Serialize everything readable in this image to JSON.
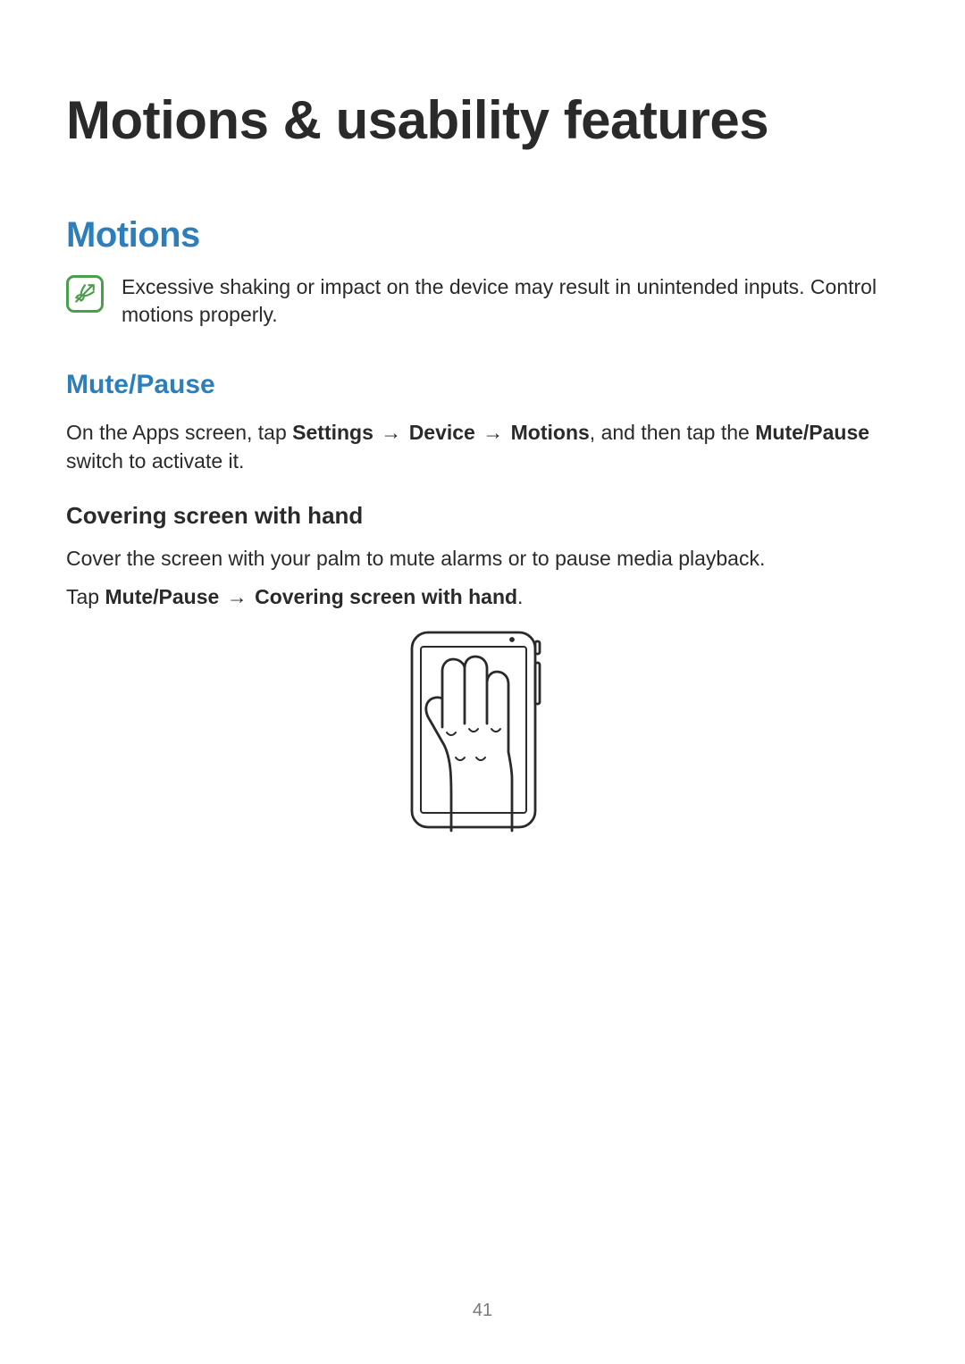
{
  "title": "Motions & usability features",
  "section_motions": {
    "heading": "Motions",
    "note": "Excessive shaking or impact on the device may result in unintended inputs. Control motions properly."
  },
  "mute_pause": {
    "heading": "Mute/Pause",
    "intro_pre": "On the Apps screen, tap ",
    "intro_b1": "Settings",
    "arrow": " → ",
    "intro_b2": "Device",
    "intro_b3": "Motions",
    "intro_mid": ", and then tap the ",
    "intro_b4": "Mute/Pause",
    "intro_post": " switch to activate it."
  },
  "covering": {
    "heading": "Covering screen with hand",
    "p1": "Cover the screen with your palm to mute alarms or to pause media playback.",
    "p2_pre": "Tap ",
    "p2_b1": "Mute/Pause",
    "arrow": " → ",
    "p2_b2": "Covering screen with hand",
    "p2_post": "."
  },
  "page_number": "41"
}
